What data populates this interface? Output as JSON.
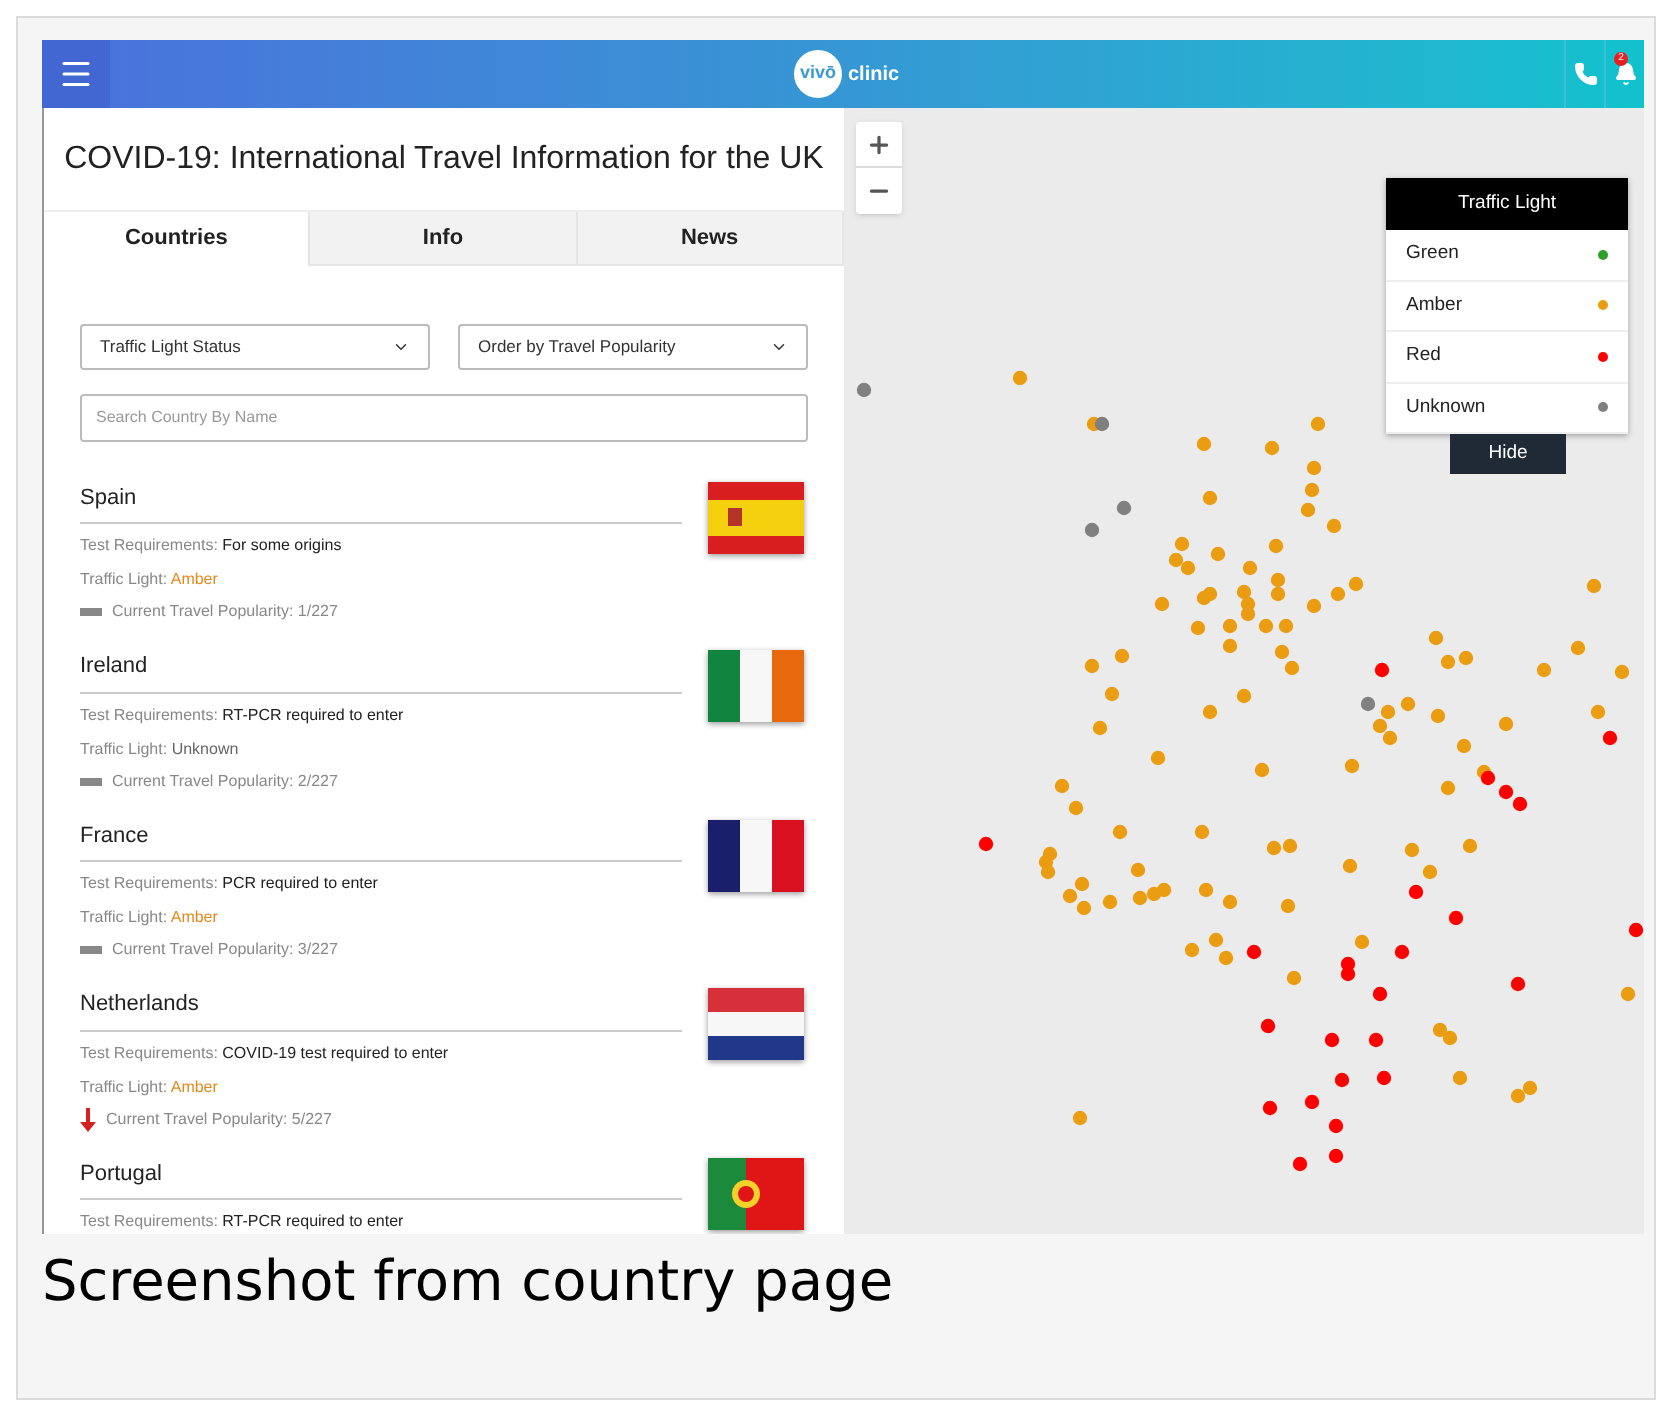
{
  "header": {
    "logo_mark": "vivō",
    "logo_text": "clinic",
    "notification_count": "2"
  },
  "title": "COVID-19: International Travel Information for the UK",
  "tabs": [
    {
      "label": "Countries",
      "selected": true
    },
    {
      "label": "Info",
      "selected": false
    },
    {
      "label": "News",
      "selected": false
    }
  ],
  "filters": [
    {
      "value": "Traffic Light Status"
    },
    {
      "value": "Order by Travel Popularity"
    }
  ],
  "search": {
    "placeholder": "Search Country By Name"
  },
  "countries": [
    {
      "name": "Spain",
      "flag": {
        "kind": "es"
      },
      "test_label": "Test Requirements:",
      "test_value": "For some origins",
      "light_label": "Traffic Light:",
      "light_value": "Amber",
      "color": "#e08a1e",
      "trend": {
        "kind": "same"
      },
      "popularity": "Current Travel Popularity: 1/227"
    },
    {
      "name": "Ireland",
      "flag": {
        "kind": "ie"
      },
      "test_label": "Test Requirements:",
      "test_value": "RT-PCR required to enter",
      "light_label": "Traffic Light:",
      "light_value": "Unknown",
      "color": "#666666",
      "trend": {
        "kind": "same"
      },
      "popularity": "Current Travel Popularity: 2/227"
    },
    {
      "name": "France",
      "flag": {
        "kind": "fr"
      },
      "test_label": "Test Requirements:",
      "test_value": "PCR required to enter",
      "light_label": "Traffic Light:",
      "light_value": "Amber",
      "color": "#e08a1e",
      "trend": {
        "kind": "same"
      },
      "popularity": "Current Travel Popularity: 3/227"
    },
    {
      "name": "Netherlands",
      "flag": {
        "kind": "nl"
      },
      "test_label": "Test Requirements:",
      "test_value": "COVID-19 test required to enter",
      "light_label": "Traffic Light:",
      "light_value": "Amber",
      "color": "#e08a1e",
      "trend": {
        "kind": "down"
      },
      "popularity": "Current Travel Popularity: 5/227"
    },
    {
      "name": "Portugal",
      "flag": {
        "kind": "pt"
      },
      "test_label": "Test Requirements:",
      "test_value": "RT-PCR required to enter"
    }
  ],
  "legend": {
    "title": "Traffic Light",
    "items": [
      {
        "label": "Green",
        "color": "#2ca02c"
      },
      {
        "label": "Amber",
        "color": "#eb9d12"
      },
      {
        "label": "Red",
        "color": "#ff0000"
      },
      {
        "label": "Unknown",
        "color": "#808080"
      }
    ],
    "hide_button": "Hide"
  },
  "caption": "Screenshot from country page"
}
